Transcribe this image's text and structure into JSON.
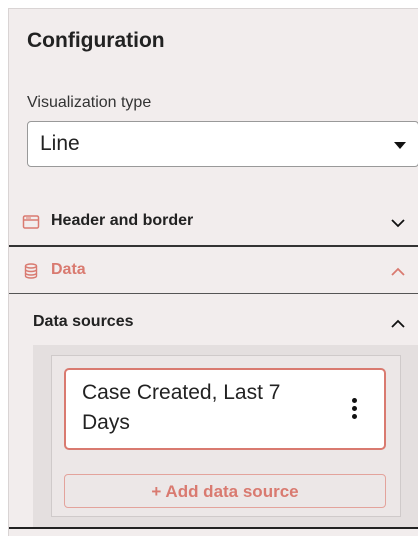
{
  "colors": {
    "accent": "#d97a70",
    "panel_bg": "#f2eded",
    "text": "#222222"
  },
  "configuration": {
    "title": "Configuration",
    "visualization_type": {
      "label": "Visualization type",
      "selected": "Line"
    }
  },
  "sections": {
    "header_and_border": {
      "label": "Header and border",
      "icon": "window-header-icon",
      "expanded": false
    },
    "data": {
      "label": "Data",
      "icon": "database-icon",
      "expanded": true
    }
  },
  "data_sources": {
    "label": "Data sources",
    "expanded": true,
    "items": [
      {
        "name": "Case Created, Last 7 Days"
      }
    ],
    "add_button_label": "+ Add data source"
  }
}
